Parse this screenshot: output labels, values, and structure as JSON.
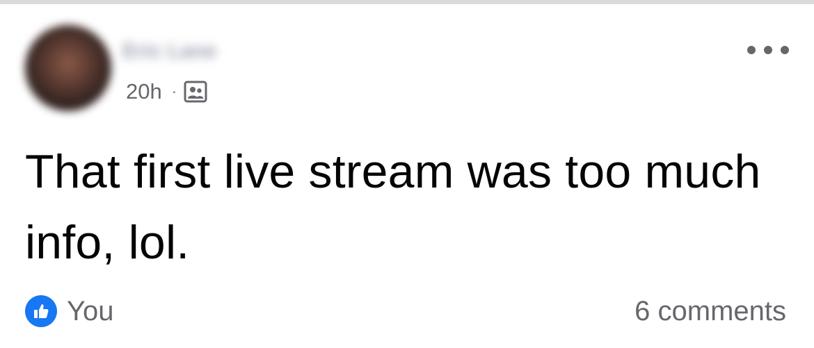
{
  "post": {
    "author_name": "Eric Lane",
    "timestamp": "20h",
    "separator": "·",
    "audience_icon": "friends-icon",
    "more_icon": "more-options-icon",
    "text": "That first live stream was too much info, lol.",
    "reactions": {
      "icon": "like-icon",
      "label": "You"
    },
    "comments_label": "6 comments"
  },
  "colors": {
    "secondary_text": "#65676b",
    "primary_text": "#050505",
    "like_blue": "#1877f2",
    "divider": "#d9dadc"
  }
}
